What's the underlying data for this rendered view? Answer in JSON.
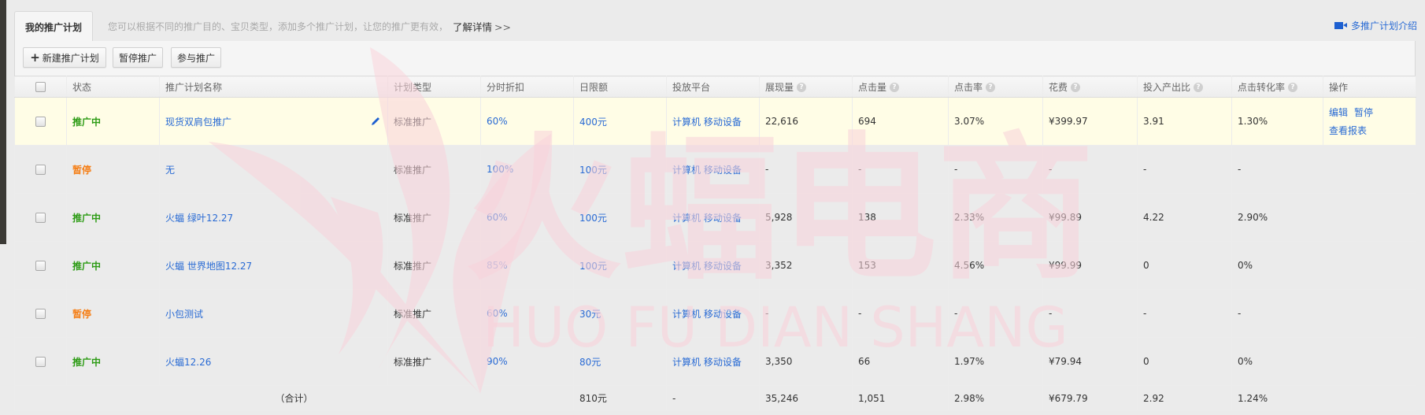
{
  "tab": {
    "active_label": "我的推广计划",
    "hint": "您可以根据不同的推广目的、宝贝类型，添加多个推广计划，让您的推广更有效，",
    "learn_more": "了解详情",
    "learn_more_arrow": ">>",
    "intro_link": "多推广计划介绍",
    "intro_icon": "video-icon"
  },
  "toolbar": {
    "new_plan": "新建推广计划",
    "pause": "暂停推广",
    "join": "参与推广"
  },
  "table": {
    "headers": [
      {
        "label": "",
        "help": false
      },
      {
        "label": "状态",
        "help": false
      },
      {
        "label": "推广计划名称",
        "help": false
      },
      {
        "label": "计划类型",
        "help": false
      },
      {
        "label": "分时折扣",
        "help": false
      },
      {
        "label": "日限额",
        "help": false
      },
      {
        "label": "投放平台",
        "help": false
      },
      {
        "label": "展现量",
        "help": true
      },
      {
        "label": "点击量",
        "help": true
      },
      {
        "label": "点击率",
        "help": true
      },
      {
        "label": "花费",
        "help": true
      },
      {
        "label": "投入产出比",
        "help": true
      },
      {
        "label": "点击转化率",
        "help": true
      },
      {
        "label": "操作",
        "help": false
      }
    ],
    "help_icon": "?",
    "rows": [
      {
        "status": "推广中",
        "status_type": "on",
        "name": "现货双肩包推广",
        "type": "标准推广",
        "discount": "60%",
        "budget": "400元",
        "platform": "计算机 移动设备",
        "impressions": "22,616",
        "clicks": "694",
        "ctr": "3.07%",
        "cost": "¥399.97",
        "roi": "3.91",
        "cvr": "1.30%",
        "highlight": true,
        "ops": [
          "编辑",
          "暂停",
          "查看报表"
        ]
      },
      {
        "status": "暂停",
        "status_type": "off",
        "name": "无",
        "type": "标准推广",
        "discount": "100%",
        "budget": "100元",
        "platform": "计算机 移动设备",
        "impressions": "-",
        "clicks": "-",
        "ctr": "-",
        "cost": "-",
        "roi": "-",
        "cvr": "-",
        "highlight": false,
        "ops": []
      },
      {
        "status": "推广中",
        "status_type": "on",
        "name": "火蝠 绿叶12.27",
        "type": "标准推广",
        "discount": "60%",
        "budget": "100元",
        "platform": "计算机 移动设备",
        "impressions": "5,928",
        "clicks": "138",
        "ctr": "2.33%",
        "cost": "¥99.89",
        "roi": "4.22",
        "cvr": "2.90%",
        "highlight": false,
        "ops": []
      },
      {
        "status": "推广中",
        "status_type": "on",
        "name": "火蝠 世界地图12.27",
        "type": "标准推广",
        "discount": "85%",
        "budget": "100元",
        "platform": "计算机 移动设备",
        "impressions": "3,352",
        "clicks": "153",
        "ctr": "4.56%",
        "cost": "¥99.99",
        "roi": "0",
        "cvr": "0%",
        "highlight": false,
        "ops": []
      },
      {
        "status": "暂停",
        "status_type": "off",
        "name": "小包测试",
        "type": "标准推广",
        "discount": "60%",
        "budget": "30元",
        "platform": "计算机 移动设备",
        "impressions": "-",
        "clicks": "-",
        "ctr": "-",
        "cost": "-",
        "roi": "-",
        "cvr": "-",
        "highlight": false,
        "ops": []
      },
      {
        "status": "推广中",
        "status_type": "on",
        "name": "火蝠12.26",
        "type": "标准推广",
        "discount": "90%",
        "budget": "80元",
        "platform": "计算机 移动设备",
        "impressions": "3,350",
        "clicks": "66",
        "ctr": "1.97%",
        "cost": "¥79.94",
        "roi": "0",
        "cvr": "0%",
        "highlight": false,
        "ops": []
      }
    ],
    "total": {
      "label": "（合计）",
      "budget": "810元",
      "platform": "-",
      "impressions": "35,246",
      "clicks": "1,051",
      "ctr": "2.98%",
      "cost": "¥679.79",
      "roi": "2.92",
      "cvr": "1.24%"
    }
  },
  "watermark": {
    "cn": "火蝠电商",
    "en": "HUO FU DIAN SHANG"
  },
  "colors": {
    "status_on": "#2c9b14",
    "status_off": "#f57f17",
    "link": "#2a6bd4",
    "highlight_row": "#fffde6",
    "watermark": "#f7c9d3"
  }
}
